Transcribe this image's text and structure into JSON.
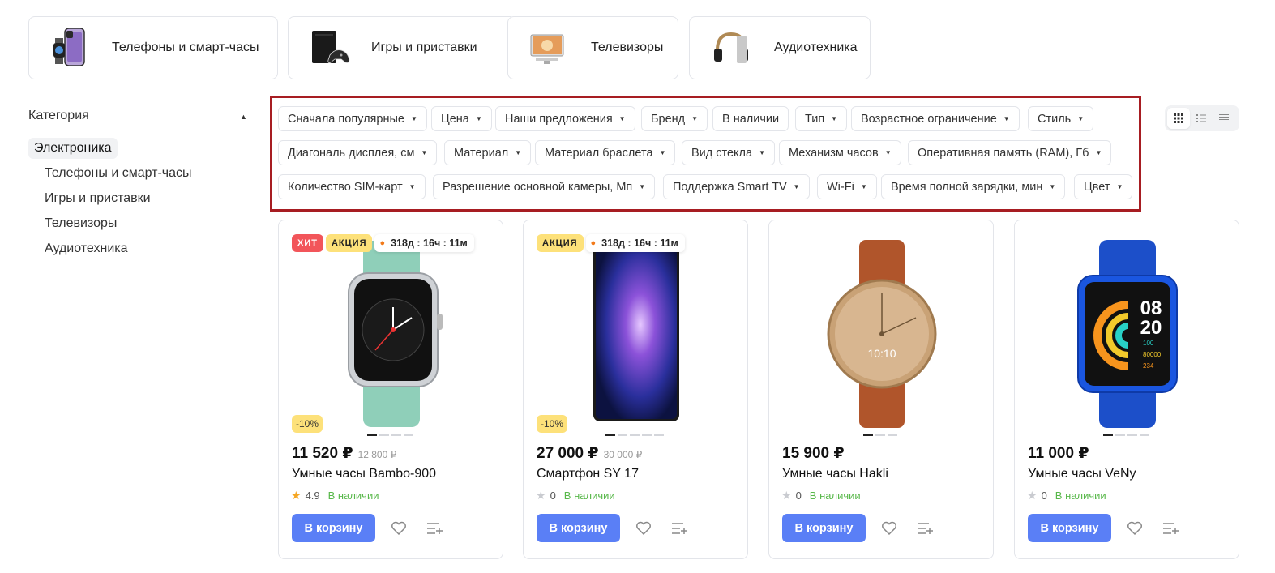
{
  "categories": [
    {
      "label": "Телефоны и смарт-часы",
      "icon": "phone-watch-thumb"
    },
    {
      "label": "Игры и приставки",
      "icon": "console-thumb"
    },
    {
      "label": "Телевизоры",
      "icon": "tv-thumb"
    },
    {
      "label": "Аудиотехника",
      "icon": "headphones-thumb"
    }
  ],
  "sidebar": {
    "title": "Категория",
    "caret": "▲",
    "active": "Электроника",
    "items": [
      "Телефоны и смарт-часы",
      "Игры и приставки",
      "Телевизоры",
      "Аудиотехника"
    ]
  },
  "filters": {
    "arrow": "▼",
    "row1": [
      "Сначала популярные",
      "Цена",
      "Наши предложения",
      "Бренд",
      "В наличии",
      "Тип",
      "Возрастное ограничение",
      "Стиль"
    ],
    "row2": [
      "Диагональ дисплея, см",
      "Материал",
      "Материал браслета",
      "Вид стекла",
      "Механизм часов",
      "Оперативная память (RAM), Гб"
    ],
    "row3": [
      "Количество SIM-карт",
      "Разрешение основной камеры, Мп",
      "Поддержка Smart TV",
      "Wi-Fi",
      "Время полной зарядки, мин",
      "Цвет"
    ],
    "no_arrow": [
      "В наличии"
    ]
  },
  "view_modes": [
    "grid-icon",
    "list-icon",
    "compact-list-icon"
  ],
  "colors": {
    "accent": "#5a7ff6",
    "highlight_border": "#a71d22",
    "in_stock": "#58b84a",
    "hit": "#f2555a",
    "sale": "#fde17a",
    "star": "#f5a623"
  },
  "products": [
    {
      "badges": {
        "hit": "ХИТ",
        "sale": "АКЦИЯ",
        "timer": "318д : 16ч : 11м"
      },
      "discount": "-10%",
      "price": "11 520 ₽",
      "old_price": "12 800 ₽",
      "title": "Умные часы Bambo-900",
      "rating": "4.9",
      "stock": "В наличии",
      "cart": "В корзину",
      "images": 4
    },
    {
      "badges": {
        "sale": "АКЦИЯ",
        "timer": "318д : 16ч : 11м"
      },
      "discount": "-10%",
      "price": "27 000 ₽",
      "old_price": "30 000 ₽",
      "title": "Смартфон SY 17",
      "rating": "0",
      "stock": "В наличии",
      "cart": "В корзину",
      "images": 5
    },
    {
      "price": "15 900 ₽",
      "title": "Умные часы Hakli",
      "rating": "0",
      "stock": "В наличии",
      "cart": "В корзину",
      "images": 3
    },
    {
      "price": "11 000 ₽",
      "title": "Умные часы VeNy",
      "rating": "0",
      "stock": "В наличии",
      "cart": "В корзину",
      "images": 4
    }
  ],
  "watch_faces": {
    "hakli_time": "10:10",
    "veny_hour": "08",
    "veny_minute": "20",
    "veny_stats": [
      "100",
      "80000",
      "234"
    ]
  }
}
